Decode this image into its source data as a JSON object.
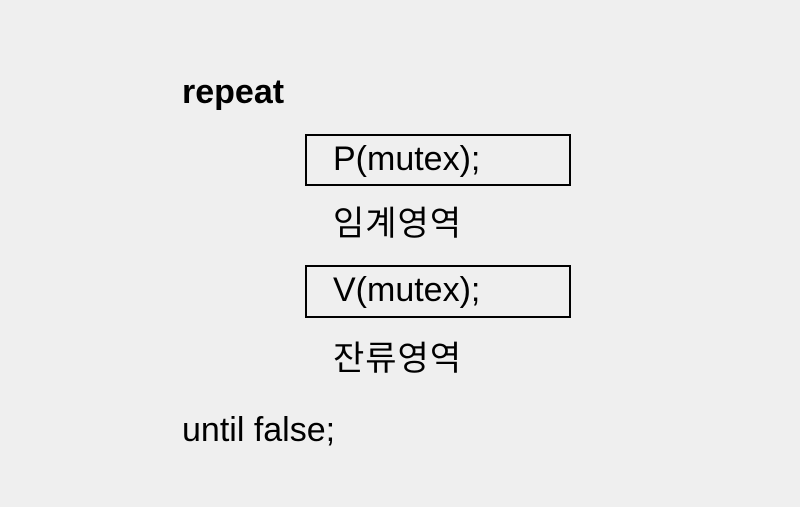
{
  "code": {
    "repeat_keyword": "repeat",
    "p_operation": "P(mutex);",
    "critical_section": "임계영역",
    "v_operation": "V(mutex);",
    "remainder_section": "잔류영역",
    "until_line": "until false;"
  }
}
